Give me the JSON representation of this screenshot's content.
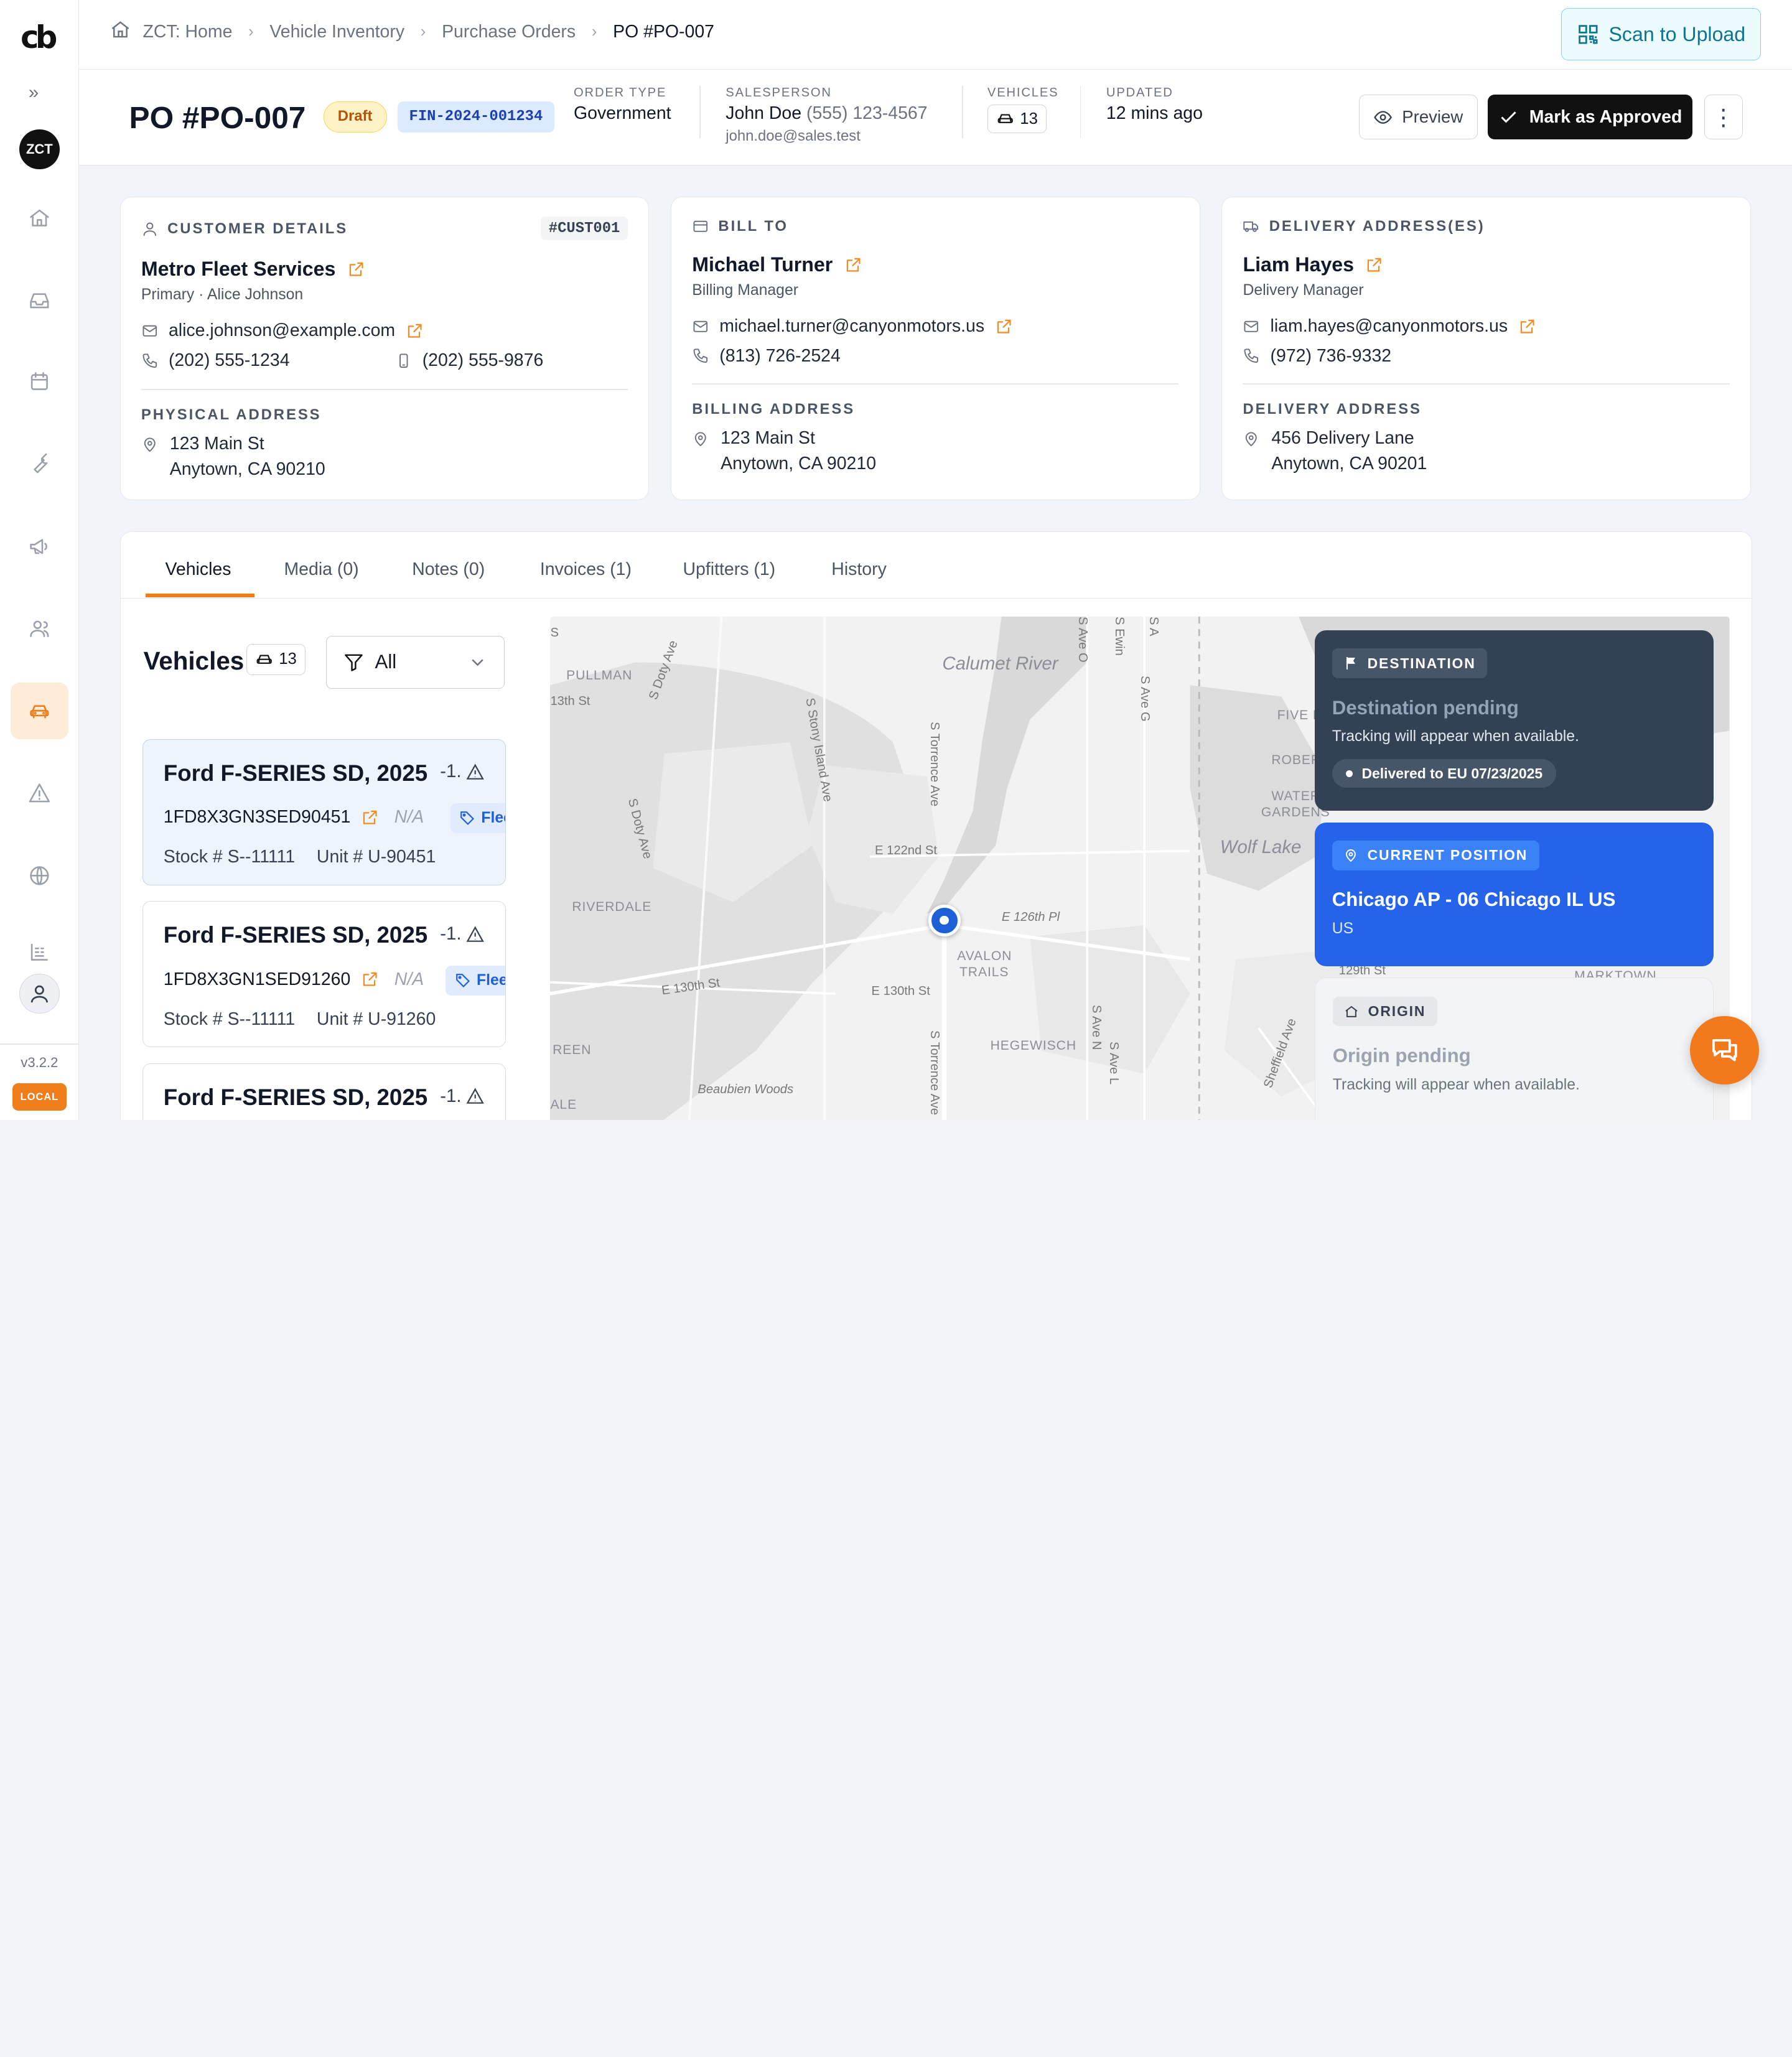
{
  "app": {
    "logo_text": "cb",
    "workspace_initials": "ZCT",
    "version": "v3.2.2",
    "env_badge": "LOCAL"
  },
  "sidebar": {
    "items": [
      {
        "icon": "home-icon",
        "active": false
      },
      {
        "icon": "inbox-icon",
        "active": false
      },
      {
        "icon": "calendar-icon",
        "active": false
      },
      {
        "icon": "wrench-icon",
        "active": false
      },
      {
        "icon": "megaphone-icon",
        "active": false
      },
      {
        "icon": "users-icon",
        "active": false
      },
      {
        "icon": "car-icon",
        "active": true
      },
      {
        "icon": "warning-icon",
        "active": false
      },
      {
        "icon": "globe-icon",
        "active": false
      },
      {
        "icon": "report-icon",
        "active": false
      }
    ]
  },
  "breadcrumb": {
    "items": [
      "ZCT: Home",
      "Vehicle Inventory",
      "Purchase Orders",
      "PO #PO-007"
    ]
  },
  "topbar": {
    "scan_label": "Scan to Upload"
  },
  "po": {
    "title": "PO #PO-007",
    "status": "Draft",
    "fin_number": "FIN-2024-001234",
    "order_type_label": "ORDER TYPE",
    "order_type": "Government",
    "salesperson_label": "SALESPERSON",
    "salesperson_name": "John Doe",
    "salesperson_phone": "(555) 123-4567",
    "salesperson_email": "john.doe@sales.test",
    "vehicles_label": "VEHICLES",
    "vehicles_count": "13",
    "updated_label": "UPDATED",
    "updated_value": "12 mins ago",
    "preview_label": "Preview",
    "approve_label": "Mark as Approved"
  },
  "customer": {
    "header": "CUSTOMER DETAILS",
    "id": "#CUST001",
    "name": "Metro Fleet Services",
    "role": "Primary · Alice Johnson",
    "email": "alice.johnson@example.com",
    "phone": "(202) 555-1234",
    "mobile": "(202) 555-9876",
    "address_label": "PHYSICAL ADDRESS",
    "address_line1": "123 Main St",
    "address_line2": "Anytown, CA 90210"
  },
  "bill_to": {
    "header": "BILL TO",
    "name": "Michael Turner",
    "role": "Billing Manager",
    "email": "michael.turner@canyonmotors.us",
    "phone": "(813) 726-2524",
    "address_label": "BILLING ADDRESS",
    "address_line1": "123 Main St",
    "address_line2": "Anytown, CA 90210"
  },
  "delivery": {
    "header": "DELIVERY ADDRESS(ES)",
    "name": "Liam Hayes",
    "role": "Delivery Manager",
    "email": "liam.hayes@canyonmotors.us",
    "phone": "(972) 736-9332",
    "address_label": "DELIVERY ADDRESS",
    "address_line1": "456 Delivery Lane",
    "address_line2": "Anytown, CA 90201"
  },
  "tabs": [
    {
      "label": "Vehicles",
      "active": true
    },
    {
      "label": "Media (0)",
      "active": false
    },
    {
      "label": "Notes (0)",
      "active": false
    },
    {
      "label": "Invoices (1)",
      "active": false
    },
    {
      "label": "Upfitters (1)",
      "active": false
    },
    {
      "label": "History",
      "active": false
    }
  ],
  "vehicles": {
    "title": "Vehicles",
    "count": "13",
    "filter_value": "All",
    "list": [
      {
        "title": "Ford F-SERIES SD, 2025",
        "status": "-1.",
        "vin": "1FD8X3GN3SED90451",
        "na": "N/A",
        "tag": "Fleet",
        "stock": "Stock # S--11111",
        "unit": "Unit # U-90451",
        "selected": true
      },
      {
        "title": "Ford F-SERIES SD, 2025",
        "status": "-1.",
        "vin": "1FD8X3GN1SED91260",
        "na": "N/A",
        "tag": "Fleet",
        "stock": "Stock # S--11111",
        "unit": "Unit # U-91260",
        "selected": false
      },
      {
        "title": "Ford F-SERIES SD, 2025",
        "status": "-1.",
        "vin": "",
        "na": "",
        "tag": "",
        "stock": "",
        "unit": "",
        "selected": false
      }
    ]
  },
  "map": {
    "labels": {
      "pullman": "PULLMAN",
      "calumet": "Calumet River",
      "wolf_lake": "Wolf Lake",
      "riverdale": "RIVERDALE",
      "avalon1": "AVALON",
      "avalon2": "TRAILS",
      "hegewisch": "HEGEWISCH",
      "beaubien": "Beaubien Woods",
      "five": "FIVE F",
      "rober": "ROBER",
      "water1": "WATER",
      "water2": "GARDENS",
      "markt": "MARKTOWN",
      "reen": "REEN",
      "ale": "ALE",
      "st13": "13th St",
      "doty1": "S Doty Ave",
      "stony": "S Stony Island Ave",
      "torrence1": "S Torrence Ave",
      "torrence2": "S Torrence Ave",
      "doty2": "S Doty Ave",
      "e122": "E 122nd St",
      "e126": "E 126th Pl",
      "e130a": "E 130th St",
      "e130b": "E 130th St",
      "st129": "129th St",
      "ave_g": "S Ave G",
      "ave_o": "S Ave O",
      "ewing": "S Ewin",
      "s_a": "S A",
      "ave_n": "S Ave N",
      "ave_l": "S Ave L",
      "sheffield": "Sheffield Ave",
      "s_top": "S"
    },
    "destination": {
      "badge": "DESTINATION",
      "title": "Destination pending",
      "subtitle": "Tracking will appear when available.",
      "pill": "Delivered to EU 07/23/2025"
    },
    "current": {
      "badge": "CURRENT POSITION",
      "title": "Chicago AP - 06 Chicago IL US",
      "subtitle": "US"
    },
    "origin": {
      "badge": "ORIGIN",
      "title": "Origin pending",
      "subtitle": "Tracking will appear when available."
    }
  },
  "colors": {
    "accent": "#ef7d1a",
    "primary_blue": "#2563eb",
    "dark_slate": "#334155"
  }
}
